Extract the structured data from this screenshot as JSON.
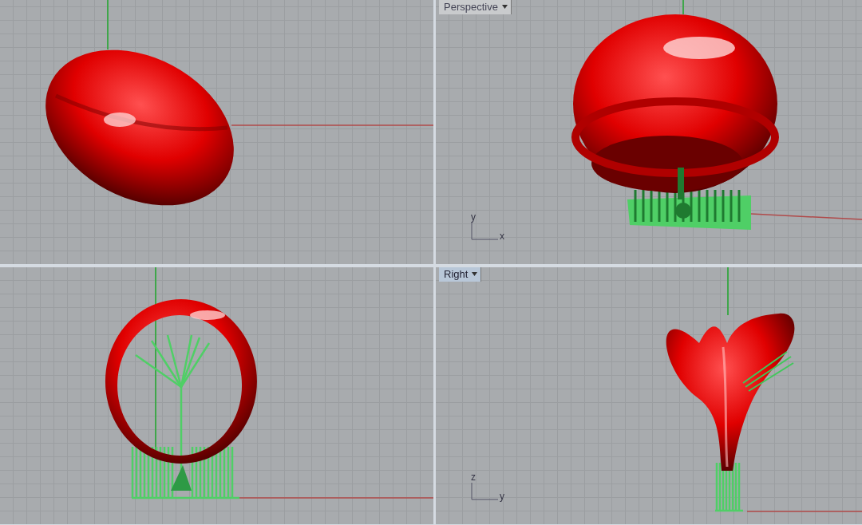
{
  "viewports": [
    {
      "kind": "top"
    },
    {
      "kind": "perspective",
      "tab": {
        "label": "Perspective",
        "selected": false
      },
      "axis_labels": [
        "y",
        "x"
      ]
    },
    {
      "kind": "front"
    },
    {
      "kind": "right",
      "tab": {
        "label": "Right",
        "selected": true
      },
      "axis_labels": [
        "z",
        "y"
      ]
    }
  ]
}
